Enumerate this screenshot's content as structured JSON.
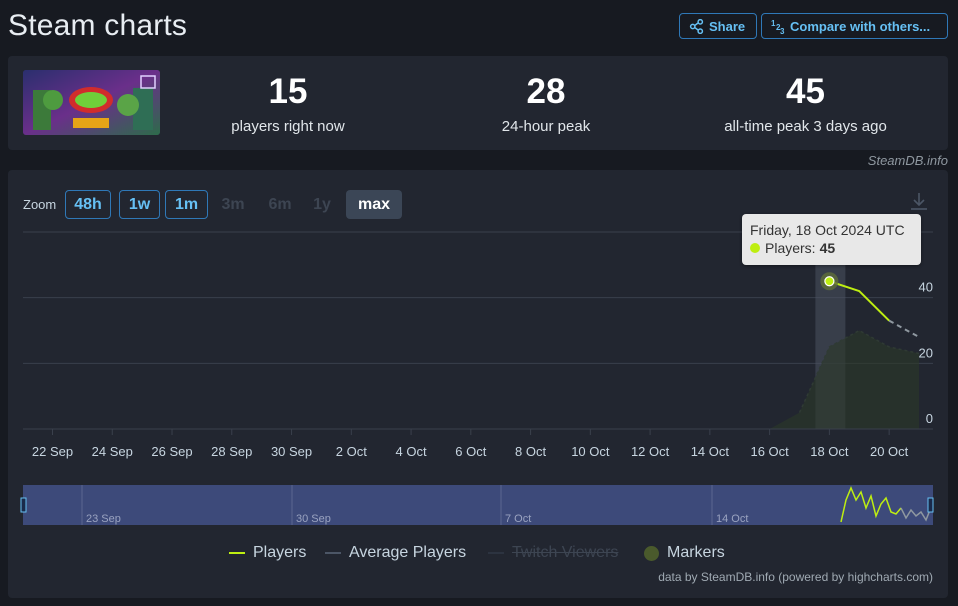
{
  "page": {
    "title": "Steam charts"
  },
  "toolbar": {
    "share_label": "Share",
    "compare_label": "Compare with others..."
  },
  "stats": {
    "current": {
      "value": "15",
      "label": "players right now"
    },
    "peak_24h": {
      "value": "28",
      "label": "24-hour peak"
    },
    "all_time": {
      "value": "45",
      "label": "all-time peak 3 days ago"
    }
  },
  "watermark": "SteamDB.info",
  "zoom": {
    "label": "Zoom",
    "options": [
      {
        "label": "48h",
        "state": "active"
      },
      {
        "label": "1w",
        "state": "active"
      },
      {
        "label": "1m",
        "state": "active"
      },
      {
        "label": "3m",
        "state": "disabled"
      },
      {
        "label": "6m",
        "state": "disabled"
      },
      {
        "label": "1y",
        "state": "disabled"
      },
      {
        "label": "max",
        "state": "selected"
      }
    ]
  },
  "tooltip": {
    "date": "Friday, 18 Oct 2024 UTC",
    "series": "Players:",
    "value": "45"
  },
  "legend": {
    "players": "Players",
    "average": "Average Players",
    "twitch": "Twitch Viewers",
    "markers": "Markers"
  },
  "credits": "data by SteamDB.info (powered by highcharts.com)",
  "colors": {
    "players": "#beee11",
    "average": "#8f98a0",
    "accent": "#66c0f4",
    "navigator_bg": "#3d4a7a"
  },
  "chart_data": {
    "type": "line",
    "x_tick_labels": [
      "22 Sep",
      "24 Sep",
      "26 Sep",
      "28 Sep",
      "30 Sep",
      "2 Oct",
      "4 Oct",
      "6 Oct",
      "8 Oct",
      "10 Oct",
      "12 Oct",
      "14 Oct",
      "16 Oct",
      "18 Oct",
      "20 Oct"
    ],
    "y_tick_labels": [
      "0",
      "20",
      "40"
    ],
    "ylim": [
      0,
      60
    ],
    "grid": true,
    "y_axis_side": "right",
    "legend_position": "bottom",
    "series": [
      {
        "name": "Players",
        "x": [
          "18 Oct",
          "19 Oct",
          "20 Oct"
        ],
        "values": [
          45,
          42,
          33
        ]
      },
      {
        "name": "Average Players",
        "x": [
          "17 Oct",
          "18 Oct",
          "19 Oct",
          "20 Oct",
          "21 Oct"
        ],
        "values": [
          5,
          25,
          30,
          25,
          23
        ]
      }
    ],
    "projection": {
      "x": [
        "20 Oct",
        "21 Oct"
      ],
      "values": [
        33,
        28
      ]
    },
    "highlight": {
      "x": "18 Oct",
      "value": 45
    },
    "navigator_labels": [
      "23 Sep",
      "30 Sep",
      "7 Oct",
      "14 Oct"
    ]
  }
}
